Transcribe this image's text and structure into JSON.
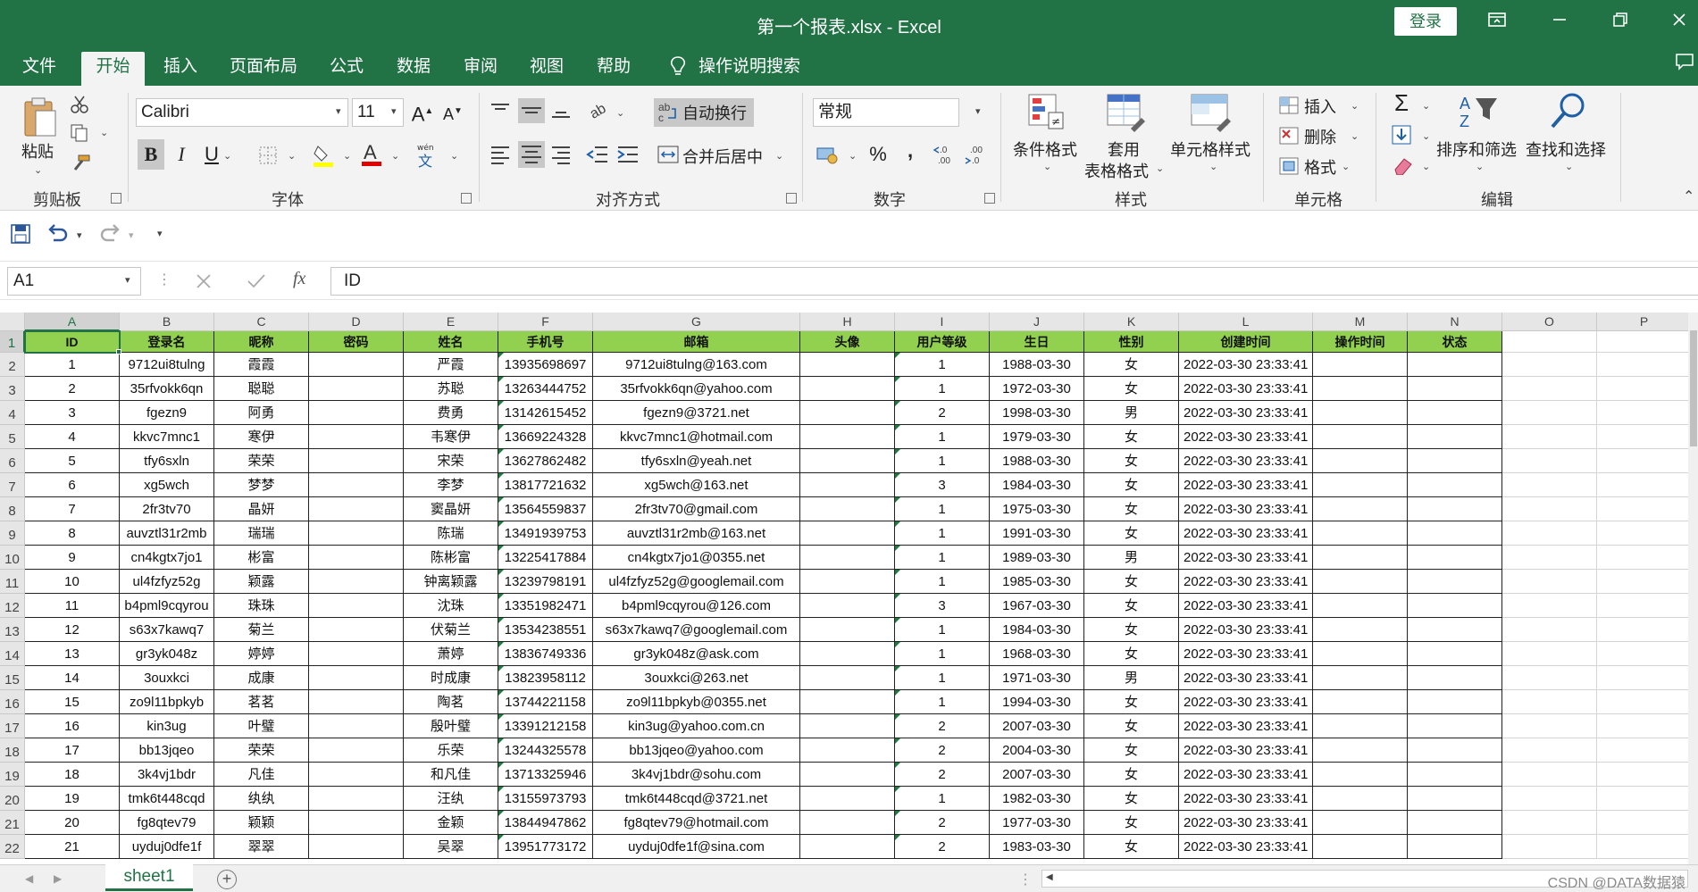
{
  "window": {
    "title": "第一个报表.xlsx  -  Excel",
    "login_label": "登录"
  },
  "tabs": [
    "文件",
    "开始",
    "插入",
    "页面布局",
    "公式",
    "数据",
    "审阅",
    "视图",
    "帮助"
  ],
  "active_tab_index": 1,
  "tell_me": "操作说明搜索",
  "ribbon": {
    "clipboard": {
      "paste": "粘贴",
      "label": "剪贴板"
    },
    "font": {
      "name": "Calibri",
      "size": "11",
      "label": "字体"
    },
    "alignment": {
      "wrap": "自动换行",
      "merge": "合并后居中",
      "label": "对齐方式"
    },
    "number": {
      "format": "常规",
      "label": "数字"
    },
    "styles": {
      "conditional": "条件格式",
      "table_1": "套用",
      "table_2": "表格格式",
      "cell_styles": "单元格样式",
      "label": "样式"
    },
    "cells": {
      "insert": "插入",
      "delete": "删除",
      "format": "格式",
      "label": "单元格"
    },
    "editing": {
      "sort_filter": "排序和筛选",
      "find_select": "查找和选择",
      "label": "编辑"
    }
  },
  "formula_bar": {
    "name_box": "A1",
    "content": "ID"
  },
  "grid": {
    "column_letters": [
      "A",
      "B",
      "C",
      "D",
      "E",
      "F",
      "G",
      "H",
      "I",
      "J",
      "K",
      "L",
      "M",
      "N",
      "O",
      "P"
    ],
    "headers": [
      "ID",
      "登录名",
      "昵称",
      "密码",
      "姓名",
      "手机号",
      "邮箱",
      "头像",
      "用户等级",
      "生日",
      "性别",
      "创建时间",
      "操作时间",
      "状态"
    ],
    "rows": [
      [
        "1",
        "9712ui8tulng",
        "霞霞",
        "",
        "严霞",
        "13935698697",
        "9712ui8tulng@163.com",
        "",
        "1",
        "1988-03-30",
        "女",
        "2022-03-30 23:33:41",
        "",
        ""
      ],
      [
        "2",
        "35rfvokk6qn",
        "聪聪",
        "",
        "苏聪",
        "13263444752",
        "35rfvokk6qn@yahoo.com",
        "",
        "1",
        "1972-03-30",
        "女",
        "2022-03-30 23:33:41",
        "",
        ""
      ],
      [
        "3",
        "fgezn9",
        "阿勇",
        "",
        "费勇",
        "13142615452",
        "fgezn9@3721.net",
        "",
        "2",
        "1998-03-30",
        "男",
        "2022-03-30 23:33:41",
        "",
        ""
      ],
      [
        "4",
        "kkvc7mnc1",
        "寒伊",
        "",
        "韦寒伊",
        "13669224328",
        "kkvc7mnc1@hotmail.com",
        "",
        "1",
        "1979-03-30",
        "女",
        "2022-03-30 23:33:41",
        "",
        ""
      ],
      [
        "5",
        "tfy6sxln",
        "荣荣",
        "",
        "宋荣",
        "13627862482",
        "tfy6sxln@yeah.net",
        "",
        "1",
        "1988-03-30",
        "女",
        "2022-03-30 23:33:41",
        "",
        ""
      ],
      [
        "6",
        "xg5wch",
        "梦梦",
        "",
        "李梦",
        "13817721632",
        "xg5wch@163.net",
        "",
        "3",
        "1984-03-30",
        "女",
        "2022-03-30 23:33:41",
        "",
        ""
      ],
      [
        "7",
        "2fr3tv70",
        "晶妍",
        "",
        "窦晶妍",
        "13564559837",
        "2fr3tv70@gmail.com",
        "",
        "1",
        "1975-03-30",
        "女",
        "2022-03-30 23:33:41",
        "",
        ""
      ],
      [
        "8",
        "auvztl31r2mb",
        "瑞瑞",
        "",
        "陈瑞",
        "13491939753",
        "auvztl31r2mb@163.net",
        "",
        "1",
        "1991-03-30",
        "女",
        "2022-03-30 23:33:41",
        "",
        ""
      ],
      [
        "9",
        "cn4kgtx7jo1",
        "彬富",
        "",
        "陈彬富",
        "13225417884",
        "cn4kgtx7jo1@0355.net",
        "",
        "1",
        "1989-03-30",
        "男",
        "2022-03-30 23:33:41",
        "",
        ""
      ],
      [
        "10",
        "ul4fzfyz52g",
        "颖露",
        "",
        "钟离颖露",
        "13239798191",
        "ul4fzfyz52g@googlemail.com",
        "",
        "1",
        "1985-03-30",
        "女",
        "2022-03-30 23:33:41",
        "",
        ""
      ],
      [
        "11",
        "b4pml9cqyrou",
        "珠珠",
        "",
        "沈珠",
        "13351982471",
        "b4pml9cqyrou@126.com",
        "",
        "3",
        "1967-03-30",
        "女",
        "2022-03-30 23:33:41",
        "",
        ""
      ],
      [
        "12",
        "s63x7kawq7",
        "菊兰",
        "",
        "伏菊兰",
        "13534238551",
        "s63x7kawq7@googlemail.com",
        "",
        "1",
        "1984-03-30",
        "女",
        "2022-03-30 23:33:41",
        "",
        ""
      ],
      [
        "13",
        "gr3yk048z",
        "婷婷",
        "",
        "萧婷",
        "13836749336",
        "gr3yk048z@ask.com",
        "",
        "1",
        "1968-03-30",
        "女",
        "2022-03-30 23:33:41",
        "",
        ""
      ],
      [
        "14",
        "3ouxkci",
        "成康",
        "",
        "时成康",
        "13823958112",
        "3ouxkci@263.net",
        "",
        "1",
        "1971-03-30",
        "男",
        "2022-03-30 23:33:41",
        "",
        ""
      ],
      [
        "15",
        "zo9l11bpkyb",
        "茗茗",
        "",
        "陶茗",
        "13744221158",
        "zo9l11bpkyb@0355.net",
        "",
        "1",
        "1994-03-30",
        "女",
        "2022-03-30 23:33:41",
        "",
        ""
      ],
      [
        "16",
        "kin3ug",
        "叶璧",
        "",
        "殷叶璧",
        "13391212158",
        "kin3ug@yahoo.com.cn",
        "",
        "2",
        "2007-03-30",
        "女",
        "2022-03-30 23:33:41",
        "",
        ""
      ],
      [
        "17",
        "bb13jqeo",
        "荣荣",
        "",
        "乐荣",
        "13244325578",
        "bb13jqeo@yahoo.com",
        "",
        "2",
        "2004-03-30",
        "女",
        "2022-03-30 23:33:41",
        "",
        ""
      ],
      [
        "18",
        "3k4vj1bdr",
        "凡佳",
        "",
        "和凡佳",
        "13713325946",
        "3k4vj1bdr@sohu.com",
        "",
        "2",
        "2007-03-30",
        "女",
        "2022-03-30 23:33:41",
        "",
        ""
      ],
      [
        "19",
        "tmk6t448cqd",
        "纨纨",
        "",
        "汪纨",
        "13155973793",
        "tmk6t448cqd@3721.net",
        "",
        "1",
        "1982-03-30",
        "女",
        "2022-03-30 23:33:41",
        "",
        ""
      ],
      [
        "20",
        "fg8qtev79",
        "颖颖",
        "",
        "金颖",
        "13844947862",
        "fg8qtev79@hotmail.com",
        "",
        "2",
        "1977-03-30",
        "女",
        "2022-03-30 23:33:41",
        "",
        ""
      ],
      [
        "21",
        "uyduj0dfe1f",
        "翠翠",
        "",
        "吴翠",
        "13951773172",
        "uyduj0dfe1f@sina.com",
        "",
        "2",
        "1983-03-30",
        "女",
        "2022-03-30 23:33:41",
        "",
        ""
      ]
    ]
  },
  "sheets": [
    "sheet1"
  ],
  "add_sheet_symbol": "+",
  "watermark": "CSDN @DATA数据猿",
  "colors": {
    "excel_green": "#217346",
    "header_fill": "#92d050"
  }
}
